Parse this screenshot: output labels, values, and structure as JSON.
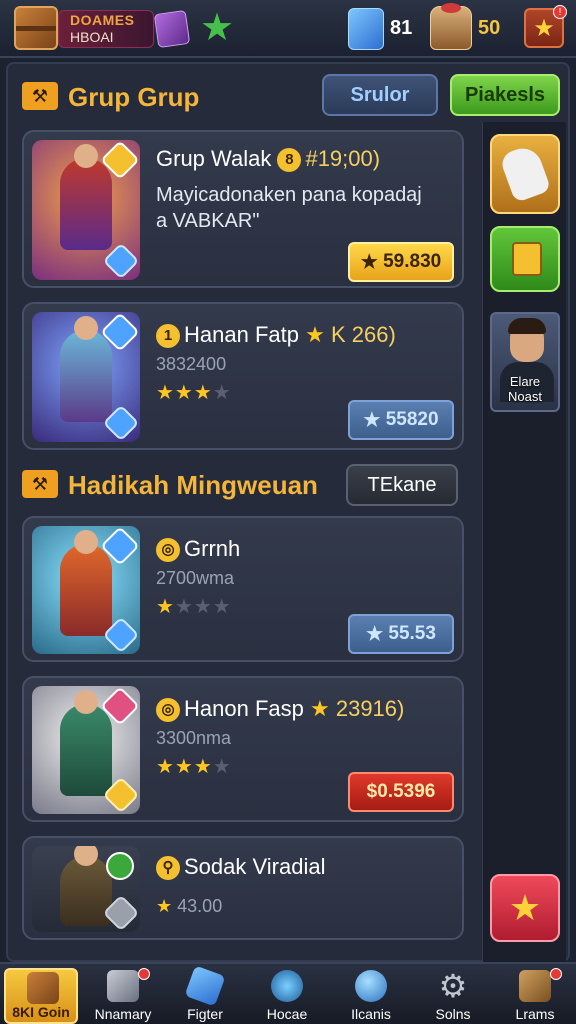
{
  "topbar": {
    "player_name_1": "DOAMES",
    "player_name_2": "HBOAI",
    "gems": "81",
    "coins": "50",
    "star_button_icon": "star-icon"
  },
  "section1": {
    "title": "Grup Grup",
    "btn_left": "Srulor",
    "btn_right": "Piakesls"
  },
  "section2": {
    "title": "Hadikah Mingweuan",
    "btn": "TEkane"
  },
  "cards": [
    {
      "title": "Grup Walak",
      "title_extra": "#19;00)",
      "desc1": "Mayicadonaken pana kopadaj",
      "desc2": "a VABKAR\"",
      "price": "59.830"
    },
    {
      "title": "Hanan Fatp",
      "title_extra": "K 266)",
      "sub": "3832400",
      "stars": 3,
      "price": "55820"
    },
    {
      "title": "Grrnh",
      "sub": "2700wma",
      "stars": 1,
      "price": "55.53"
    },
    {
      "title": "Hanon Fasp",
      "title_extra": "23916)",
      "sub": "3300nma",
      "stars": 3,
      "price": "$0.5396"
    },
    {
      "title": "Sodak Viradial",
      "sub": "43.00",
      "stars": 1
    }
  ],
  "sidebar": {
    "hero_name": "Elare Noast"
  },
  "nav": [
    {
      "label": "8KI Goin",
      "icon": "chest-icon"
    },
    {
      "label": "Nnamary",
      "icon": "cube-icon"
    },
    {
      "label": "Figter",
      "icon": "crystal-icon"
    },
    {
      "label": "Hocae",
      "icon": "bomb-icon"
    },
    {
      "label": "Ilcanis",
      "icon": "orb-icon"
    },
    {
      "label": "Solns",
      "icon": "gear-icon"
    },
    {
      "label": "Lrams",
      "icon": "chest-open-icon"
    }
  ]
}
